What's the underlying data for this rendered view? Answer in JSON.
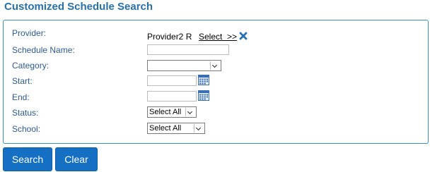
{
  "title": "Customized Schedule Search",
  "fields": {
    "provider": {
      "label": "Provider:",
      "value": "Provider2 R",
      "select_link": "Select  >>"
    },
    "schedule_name": {
      "label": "Schedule Name:",
      "value": ""
    },
    "category": {
      "label": "Category:",
      "selected": ""
    },
    "start": {
      "label": "Start:",
      "value": ""
    },
    "end": {
      "label": "End:",
      "value": ""
    },
    "status": {
      "label": "Status:",
      "selected": "Select All"
    },
    "school": {
      "label": "School:",
      "selected": "Select All"
    }
  },
  "buttons": {
    "search": "Search",
    "clear": "Clear"
  },
  "colors": {
    "title": "#2870a8",
    "label": "#2c5a96",
    "panel_border": "#3c8fb8",
    "button_bg": "#1570c4"
  }
}
